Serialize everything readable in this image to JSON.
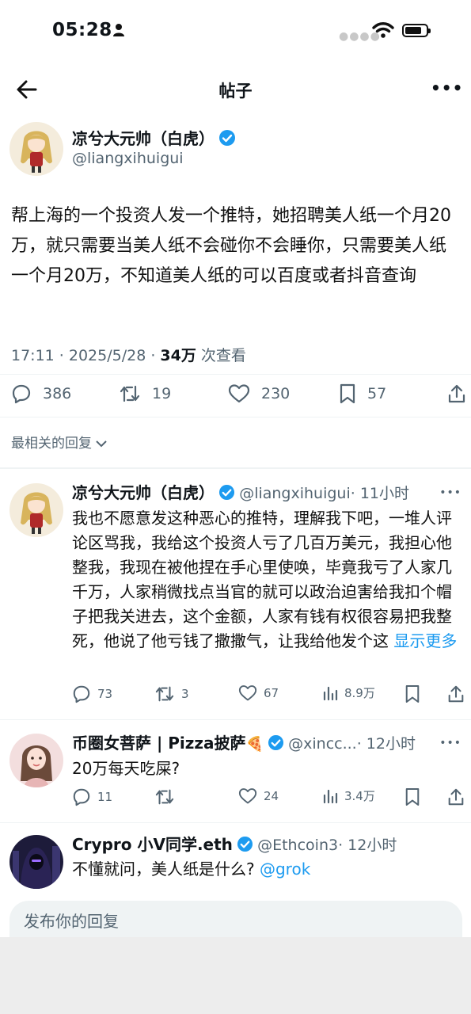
{
  "status_bar": {
    "time": "05:28"
  },
  "nav": {
    "title": "帖子"
  },
  "post": {
    "author_name": "凉兮大元帅（白虎）",
    "author_handle": "@liangxihuigui",
    "text": "帮上海的一个投资人发一个推特，她招聘美人纸一个月20万，就只需要当美人纸不会碰你不会睡你，只需要美人纸一个月20万，不知道美人纸的可以百度或者抖音查询",
    "time": "17:11 · 2025/5/28 · ",
    "views_count": "34万",
    "views_label": " 次查看",
    "replies": "386",
    "reposts": "19",
    "likes": "230",
    "bookmarks": "57"
  },
  "sort_label": "最相关的回复",
  "replies": [
    {
      "name": "凉兮大元帅（白虎）",
      "handle": "@liangxihuigui",
      "time": "· 11小时",
      "text": "我也不愿意发这种恶心的推特，理解我下吧，一堆人评论区骂我，我给这个投资人亏了几百万美元，我担心他整我，我现在被他捏在手心里使唤，毕竟我亏了人家几千万，人家稍微找点当官的就可以政治迫害给我扣个帽子把我关进去，这个金额，人家有钱有权很容易把我整死，他说了他亏钱了撒撒气，让我给他发个这",
      "show_more": "显示更多",
      "replies": "73",
      "reposts": "3",
      "likes": "67",
      "views": "8.9万"
    },
    {
      "name": "币圈女菩萨 | Pizza披萨",
      "emoji": "🍕",
      "handle": "@xincc...",
      "time": "· 12小时",
      "text": "20万每天吃屎?",
      "replies": "11",
      "reposts": "",
      "likes": "24",
      "views": "3.4万"
    },
    {
      "name": "Crypro 小V同学.eth",
      "handle": "@Ethcoin3",
      "time": "· 12小时",
      "text": "不懂就问，美人纸是什么?",
      "mention": "@grok"
    }
  ],
  "compose": {
    "placeholder": "发布你的回复"
  },
  "colors": {
    "accent": "#1d9bf0",
    "secondary_text": "#536471"
  }
}
